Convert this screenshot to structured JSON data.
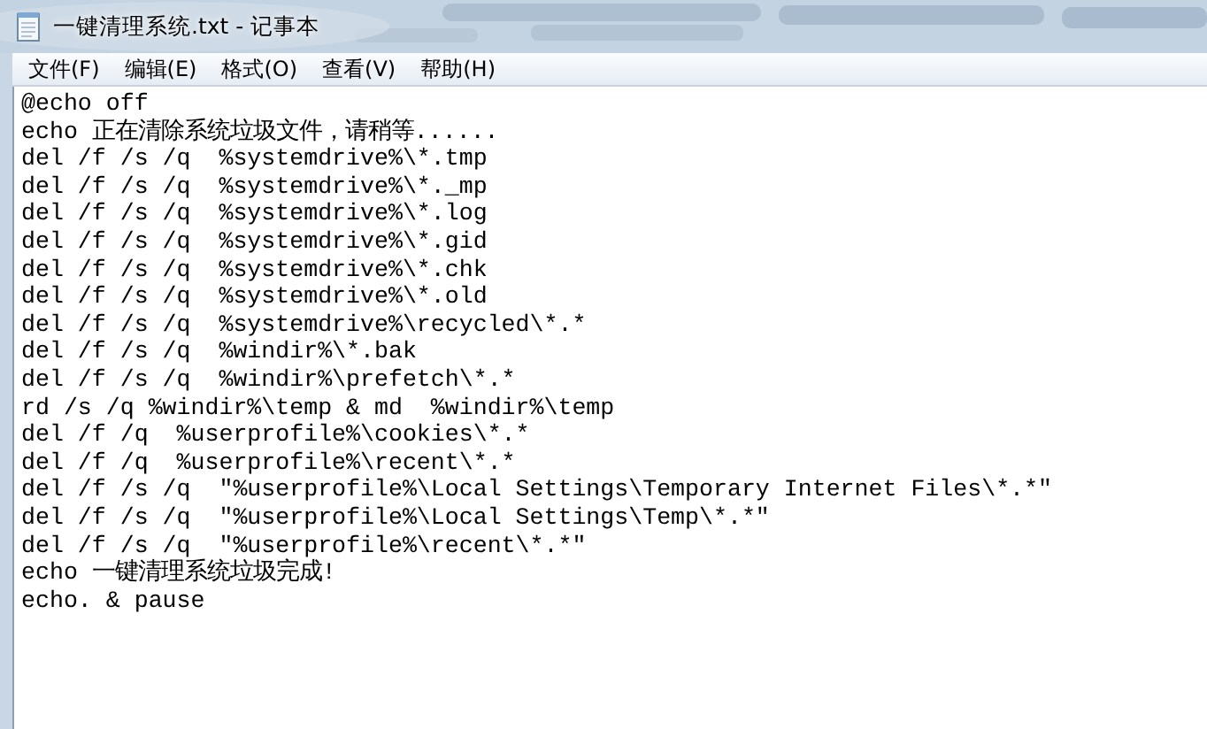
{
  "window": {
    "title": "一键清理系统.txt - 记事本"
  },
  "menu": [
    {
      "label": "文件(F)"
    },
    {
      "label": "编辑(E)"
    },
    {
      "label": "格式(O)"
    },
    {
      "label": "查看(V)"
    },
    {
      "label": "帮助(H)"
    }
  ],
  "lines": [
    "@echo off",
    "echo 正在清除系统垃圾文件，请稍等......",
    "del /f /s /q  %systemdrive%\\*.tmp",
    "del /f /s /q  %systemdrive%\\*._mp",
    "del /f /s /q  %systemdrive%\\*.log",
    "del /f /s /q  %systemdrive%\\*.gid",
    "del /f /s /q  %systemdrive%\\*.chk",
    "del /f /s /q  %systemdrive%\\*.old",
    "del /f /s /q  %systemdrive%\\recycled\\*.*",
    "del /f /s /q  %windir%\\*.bak",
    "del /f /s /q  %windir%\\prefetch\\*.*",
    "rd /s /q %windir%\\temp & md  %windir%\\temp",
    "del /f /q  %userprofile%\\cookies\\*.*",
    "del /f /q  %userprofile%\\recent\\*.*",
    "del /f /s /q  \"%userprofile%\\Local Settings\\Temporary Internet Files\\*.*\"",
    "del /f /s /q  \"%userprofile%\\Local Settings\\Temp\\*.*\"",
    "del /f /s /q  \"%userprofile%\\recent\\*.*\"",
    "echo 一键清理系统垃圾完成!",
    "echo. & pause"
  ]
}
